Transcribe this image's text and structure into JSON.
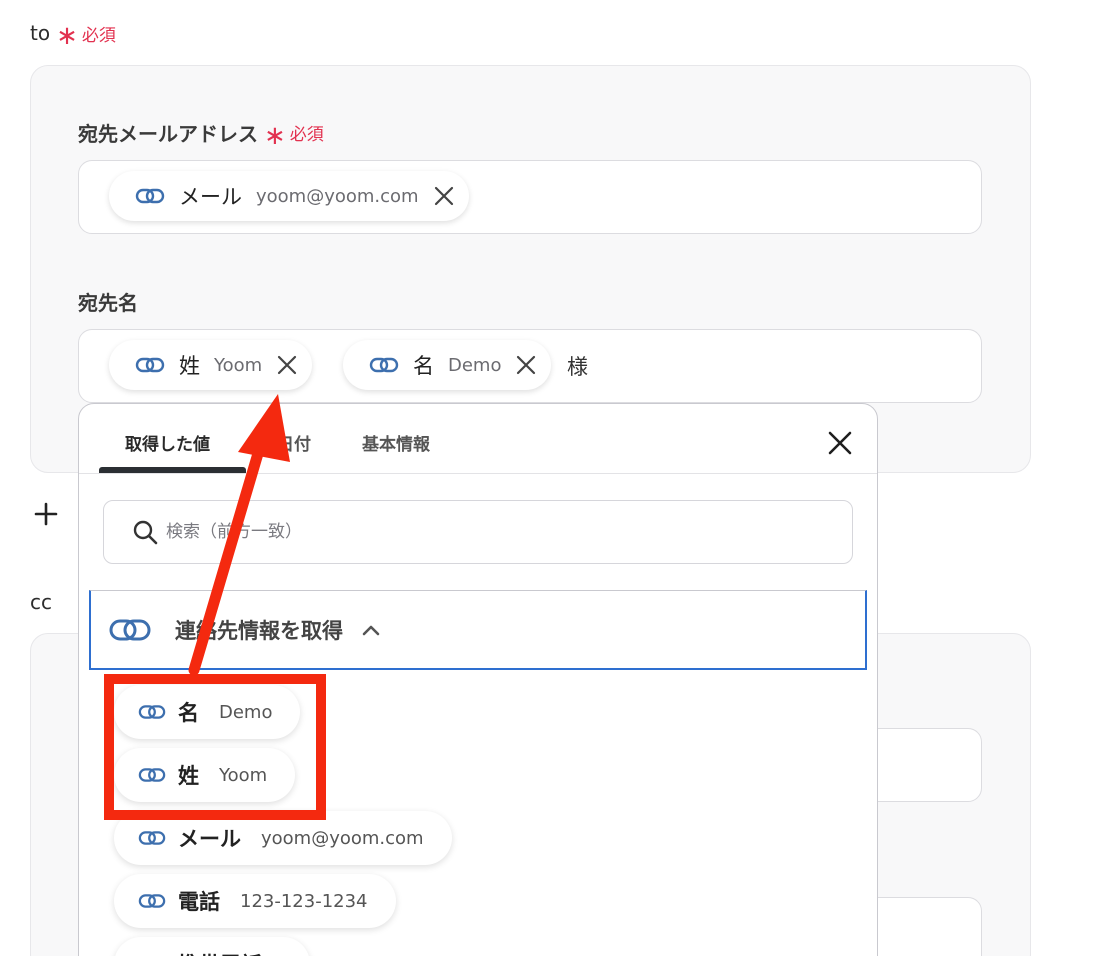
{
  "to_section": {
    "label": "to",
    "required_label": "必須"
  },
  "email_field": {
    "label": "宛先メールアドレス",
    "required_label": "必須",
    "chip": {
      "key": "メール",
      "value": "yoom@yoom.com"
    }
  },
  "name_field": {
    "label": "宛先名",
    "chips": [
      {
        "key": "姓",
        "value": "Yoom"
      },
      {
        "key": "名",
        "value": "Demo"
      }
    ],
    "suffix": "様"
  },
  "cc_section": {
    "label": "cc"
  },
  "dropdown": {
    "tabs": [
      "取得した値",
      "日付",
      "基本情報"
    ],
    "active_tab": 0,
    "search_placeholder": "検索（前方一致）",
    "group_title": "連絡先情報を取得",
    "items": [
      {
        "key": "名",
        "value": "Demo"
      },
      {
        "key": "姓",
        "value": "Yoom"
      },
      {
        "key": "メール",
        "value": "yoom@yoom.com"
      },
      {
        "key": "電話",
        "value": "123-123-1234"
      },
      {
        "key": "携帯電話",
        "value": ""
      }
    ]
  },
  "colors": {
    "accent_blue": "#2e6fd0",
    "required_red": "#e2314f",
    "highlight_red": "#f4290f",
    "link_icon": "#3d6fae"
  }
}
